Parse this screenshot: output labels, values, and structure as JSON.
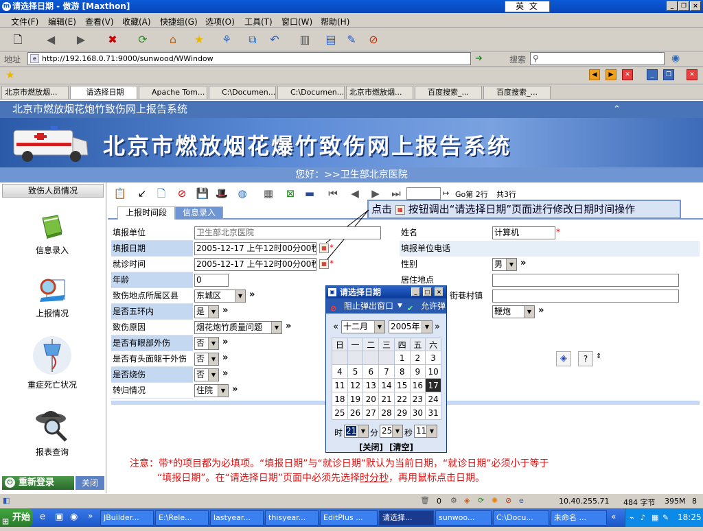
{
  "window": {
    "title": "请选择日期 - 傲游 [Maxthon]",
    "ime": "英 文"
  },
  "menu": [
    "文件(F)",
    "编辑(E)",
    "查看(V)",
    "收藏(A)",
    "快捷组(G)",
    "选项(O)",
    "工具(T)",
    "窗口(W)",
    "帮助(H)"
  ],
  "address": {
    "label": "地址",
    "url": "http://192.168.0.71:9000/sunwood/WWindow",
    "search_label": "搜索"
  },
  "tabs": [
    "北京市燃放烟...",
    "请选择日期",
    "Apache Tom...",
    "C:\\Documen...",
    "C:\\Documen...",
    "北京市燃放烟...",
    "百度搜索_...",
    "百度搜索_..."
  ],
  "app": {
    "system_title": "北京市燃放烟花炮竹致伤网上报告系统",
    "banner_title": "北京市燃放烟花爆竹致伤网上报告系统",
    "greeting": "您好：>>卫生部北京医院"
  },
  "sidebar": {
    "header": "致伤人员情况",
    "items": [
      "信息录入",
      "上报情况",
      "重症死亡状况",
      "报表查询"
    ],
    "relogin": "重新登录",
    "close": "关闭"
  },
  "main_toolbar": {
    "page_input": "",
    "goto_text": "Go第 2行",
    "total_text": "共3行"
  },
  "subtabs": [
    "上报时间段",
    "信息录入"
  ],
  "callout": {
    "prefix": "点击",
    "suffix": "按钮调出“请选择日期”页面进行修改日期时间操作"
  },
  "form": {
    "report_unit_label": "填报单位",
    "report_unit_value": "卫生部北京医院",
    "name_label": "姓名",
    "name_value": "计算机",
    "report_date_label": "填报日期",
    "report_date_value": "2005-12-17 上午12时00分00秒",
    "unit_phone_label": "填报单位电话",
    "visit_time_label": "就诊时间",
    "visit_time_value": "2005-12-17 上午12时00分00秒",
    "gender_label": "性别",
    "gender_value": "男",
    "age_label": "年龄",
    "age_value": "0",
    "residence_label": "居住地点",
    "district_label": "致伤地点所属区县",
    "district_value": "东城区",
    "street_label": "街巷村镇",
    "fifth_ring_label": "是否五环内",
    "fifth_ring_value": "是",
    "firework_value": "鞭炮",
    "cause_label": "致伤原因",
    "cause_value": "烟花炮竹质量问题",
    "eye_label": "是否有眼部外伤",
    "eye_value": "否",
    "head_label": "是否有头面躯干外伤",
    "head_value": "否",
    "burn_label": "是否烧伤",
    "burn_value": "否",
    "outcome_label": "转归情况",
    "outcome_value": "住院",
    "more": "»"
  },
  "note": {
    "line1": "注意：带*的项目都为必填项。“填报日期”与“就诊日期”默认为当前日期，“就诊日期”必须小于等于",
    "line2_a": "“填报日期”。在“请选择日期”页面中必须先选择",
    "line2_u": "时分秒",
    "line2_b": "，再用鼠标点击日期。"
  },
  "popup": {
    "title": "请选择日期",
    "block_text": "阻止弹出窗口",
    "allow_text": "允许弹",
    "month": "十二月",
    "year": "2005年",
    "weekdays": [
      "日",
      "一",
      "二",
      "三",
      "四",
      "五",
      "六"
    ],
    "weeks": [
      [
        "",
        "",
        "",
        "",
        "1",
        "2",
        "3"
      ],
      [
        "4",
        "5",
        "6",
        "7",
        "8",
        "9",
        "10"
      ],
      [
        "11",
        "12",
        "13",
        "14",
        "15",
        "16",
        "17"
      ],
      [
        "18",
        "19",
        "20",
        "21",
        "22",
        "23",
        "24"
      ],
      [
        "25",
        "26",
        "27",
        "28",
        "29",
        "30",
        "31"
      ]
    ],
    "selected_day": "17",
    "hour_label": "时",
    "hour_value": "21",
    "minute_label": "分",
    "minute_value": "25",
    "second_label": "秒",
    "second_value": "11",
    "close_btn": "[关闭]",
    "clear_btn": "[清空]"
  },
  "statusbar": {
    "count": "0",
    "ip": "10.40.255.71",
    "bytes": "484 字节",
    "memory": "395M",
    "extra": "8"
  },
  "taskbar": {
    "start": "开始",
    "items": [
      "JBuilder...",
      "E:\\Rele...",
      "lastyear...",
      "thisyear...",
      "EditPlus ...",
      "请选择...",
      "sunwoo...",
      "C:\\Docu...",
      "未命名 ..."
    ],
    "clock": "18:25"
  }
}
